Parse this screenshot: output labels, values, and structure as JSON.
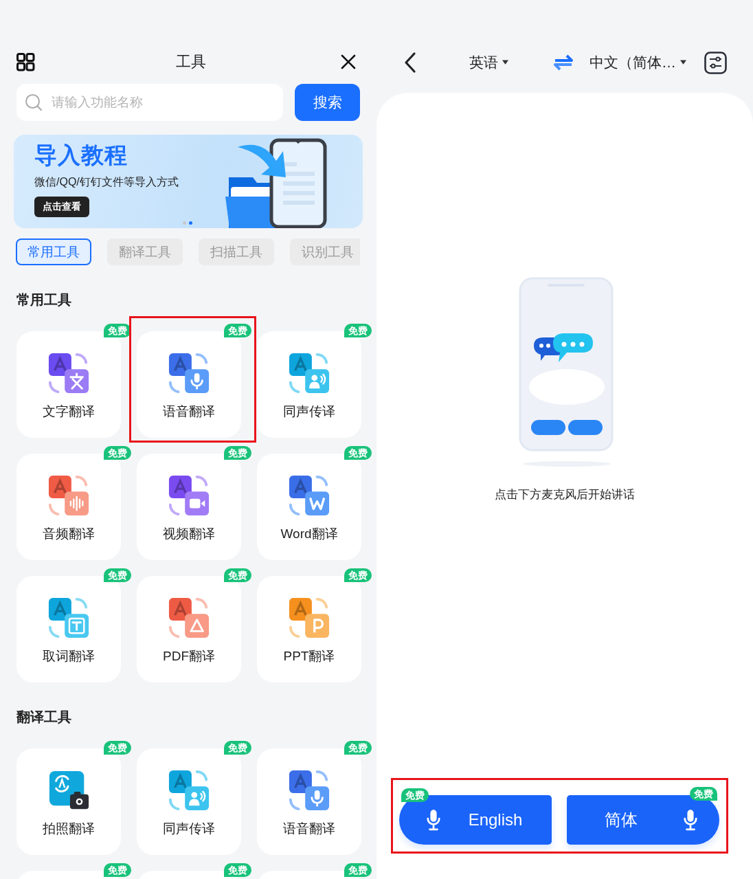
{
  "left": {
    "title": "工具",
    "search": {
      "placeholder": "请输入功能名称",
      "button": "搜索"
    },
    "banner": {
      "title": "导入教程",
      "subtitle": "微信/QQ/钉钉文件等导入方式",
      "button": "点击查看",
      "dots": [
        {
          "selected": false
        },
        {
          "selected": true
        }
      ]
    },
    "tabs": [
      {
        "label": "常用工具",
        "selected": true
      },
      {
        "label": "翻译工具",
        "selected": false
      },
      {
        "label": "扫描工具",
        "selected": false
      },
      {
        "label": "识别工具",
        "selected": false
      }
    ],
    "sections": [
      {
        "title": "常用工具",
        "items": [
          {
            "label": "文字翻译",
            "kind": "text",
            "badge": "免费",
            "highlighted": false
          },
          {
            "label": "语音翻译",
            "kind": "voice",
            "badge": "免费",
            "highlighted": true
          },
          {
            "label": "同声传译",
            "kind": "simul",
            "badge": "免费",
            "highlighted": false
          },
          {
            "label": "音频翻译",
            "kind": "audio",
            "badge": "免费",
            "highlighted": false
          },
          {
            "label": "视频翻译",
            "kind": "video",
            "badge": "免费",
            "highlighted": false
          },
          {
            "label": "Word翻译",
            "kind": "word",
            "badge": "免费",
            "highlighted": false
          },
          {
            "label": "取词翻译",
            "kind": "pick",
            "badge": "免费",
            "highlighted": false
          },
          {
            "label": "PDF翻译",
            "kind": "pdf",
            "badge": "免费",
            "highlighted": false
          },
          {
            "label": "PPT翻译",
            "kind": "ppt",
            "badge": "免费",
            "highlighted": false
          }
        ]
      },
      {
        "title": "翻译工具",
        "items": [
          {
            "label": "拍照翻译",
            "kind": "photo",
            "badge": "免费",
            "highlighted": false
          },
          {
            "label": "同声传译",
            "kind": "simul",
            "badge": "免费",
            "highlighted": false
          },
          {
            "label": "语音翻译",
            "kind": "voice",
            "badge": "免费",
            "highlighted": false
          },
          {
            "badge": "免费",
            "highlighted": false
          },
          {
            "badge": "免费",
            "highlighted": false
          },
          {
            "badge": "免费",
            "highlighted": false
          }
        ]
      }
    ]
  },
  "right": {
    "source_language": "英语",
    "target_language": "中文（简体…",
    "hint": "点击下方麦克风后开始讲话",
    "mic_buttons": {
      "highlighted": true,
      "items": [
        {
          "label": "English",
          "badge": "免费"
        },
        {
          "label": "简体",
          "badge": "免费"
        }
      ]
    }
  }
}
